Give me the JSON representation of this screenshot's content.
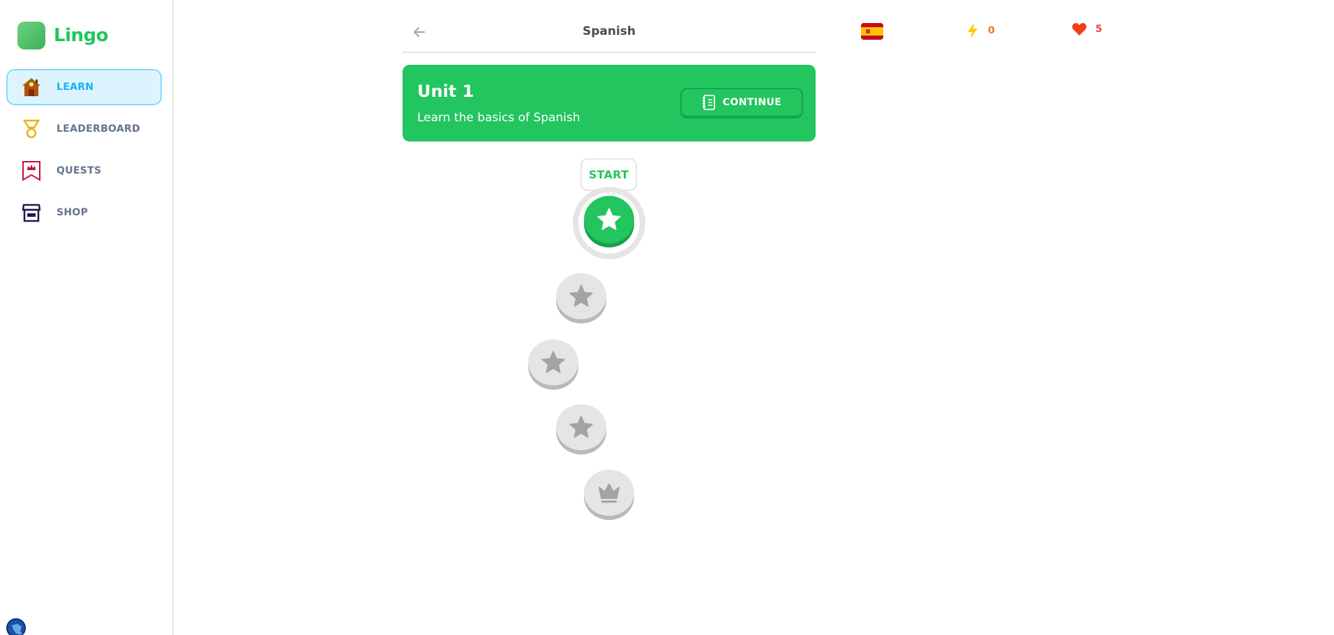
{
  "app": {
    "name": "Lingo"
  },
  "nav": {
    "items": [
      {
        "label": "LEARN",
        "icon": "learn-house-icon",
        "active": true
      },
      {
        "label": "LEADERBOARD",
        "icon": "leaderboard-medal-icon",
        "active": false
      },
      {
        "label": "QUESTS",
        "icon": "quests-banner-icon",
        "active": false
      },
      {
        "label": "SHOP",
        "icon": "shop-store-icon",
        "active": false
      }
    ]
  },
  "header": {
    "title": "Spanish",
    "back_icon": "arrow-left-icon"
  },
  "stats": {
    "flag_icon": "spain-flag-icon",
    "points": "0",
    "points_icon": "lightning-bolt-icon",
    "hearts": "5",
    "hearts_icon": "heart-icon"
  },
  "unit": {
    "title": "Unit 1",
    "description": "Learn the basics of Spanish",
    "continue_label": "CONTINUE",
    "continue_icon": "notebook-icon"
  },
  "path": {
    "start_label": "START",
    "lessons": [
      {
        "state": "active",
        "icon": "star-icon"
      },
      {
        "state": "locked",
        "icon": "star-icon"
      },
      {
        "state": "locked",
        "icon": "star-icon"
      },
      {
        "state": "locked",
        "icon": "star-icon"
      },
      {
        "state": "locked",
        "icon": "crown-icon"
      }
    ]
  },
  "colors": {
    "brand_green": "#22c55e",
    "active_nav_bg": "#ddf4ff",
    "active_nav_text": "#1cb0f6",
    "locked_gray": "#e5e5e5"
  }
}
